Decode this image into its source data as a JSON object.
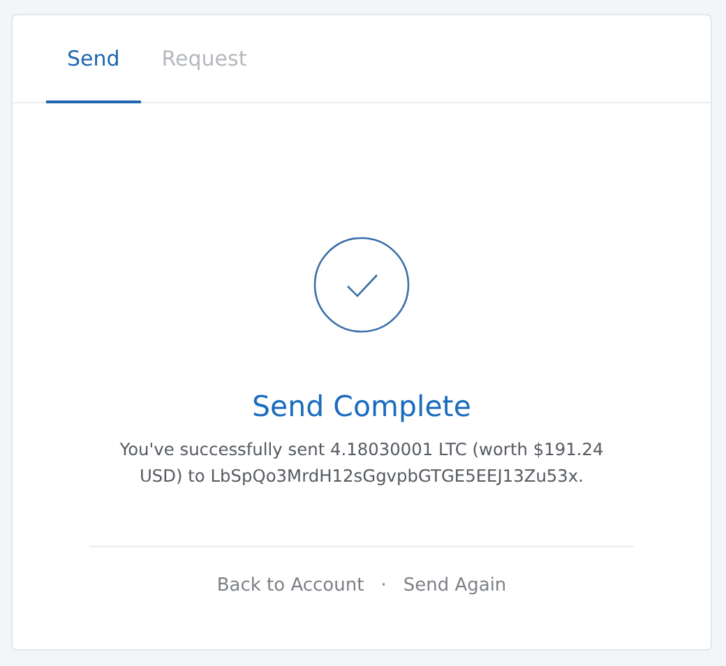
{
  "tabs": [
    {
      "label": "Send",
      "selected": true
    },
    {
      "label": "Request",
      "selected": false
    }
  ],
  "result": {
    "title": "Send Complete",
    "message": "You've successfully sent 4.18030001 LTC (worth $191.24 USD) to LbSpQo3MrdH12sGgvpbGTGE5EEJ13Zu53x."
  },
  "actions": {
    "links": [
      "Back to Account",
      "Send Again"
    ],
    "separator": "·"
  }
}
